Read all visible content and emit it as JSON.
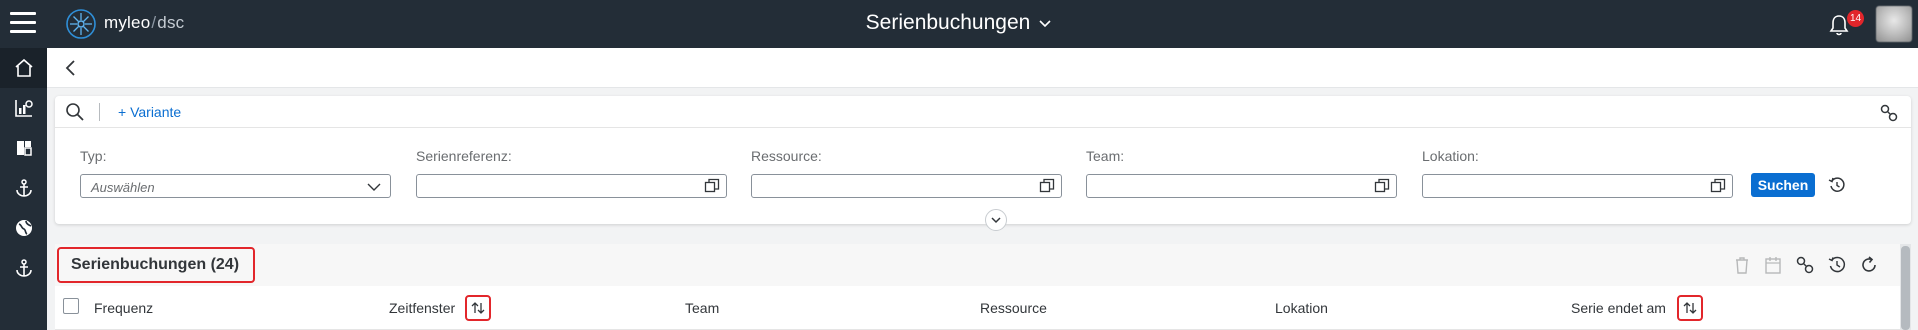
{
  "app": {
    "brand_name": "myleo",
    "brand_separator": "/",
    "brand_sub": "dsc",
    "title": "Serienbuchungen",
    "notification_count": "14"
  },
  "sidenav": {
    "items": [
      {
        "icon": "home-icon",
        "active": true
      },
      {
        "icon": "chart-settings-icon"
      },
      {
        "icon": "dashboard-icon"
      },
      {
        "icon": "anchor-icon"
      },
      {
        "icon": "globe-icon"
      },
      {
        "icon": "anchor-icon"
      }
    ]
  },
  "filterbar": {
    "variant_label": "+ Variante",
    "fields": [
      {
        "label": "Typ:",
        "placeholder": "Auswählen",
        "type": "select"
      },
      {
        "label": "Serienreferenz:",
        "placeholder": "",
        "type": "valuehelp"
      },
      {
        "label": "Ressource:",
        "placeholder": "",
        "type": "valuehelp"
      },
      {
        "label": "Team:",
        "placeholder": "",
        "type": "valuehelp"
      },
      {
        "label": "Lokation:",
        "placeholder": "",
        "type": "valuehelp"
      }
    ],
    "search_button": "Suchen"
  },
  "table": {
    "title": "Serienbuchungen (24)",
    "columns": [
      "Frequenz",
      "Zeitfenster",
      "Team",
      "Ressource",
      "Lokation",
      "Serie endet am"
    ],
    "sortable_columns": [
      "Zeitfenster",
      "Serie endet am"
    ]
  },
  "colors": {
    "shell": "#232d37",
    "accent": "#0a6ed1",
    "highlight": "#e2262b"
  }
}
